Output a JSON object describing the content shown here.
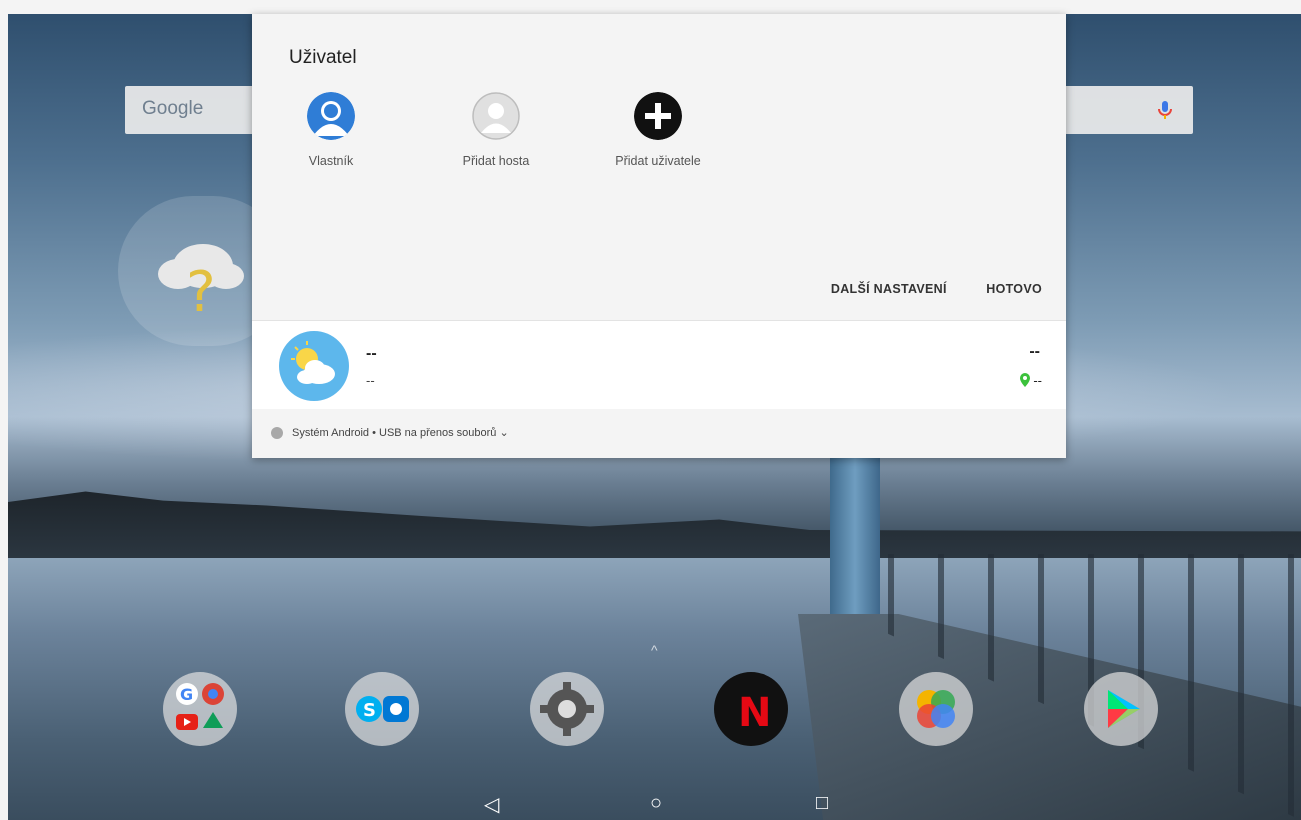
{
  "panel": {
    "title": "Uživatel",
    "users": [
      {
        "label": "Vlastník",
        "icon": "user-avatar-icon"
      },
      {
        "label": "Přidat hosta",
        "icon": "guest-avatar-icon"
      },
      {
        "label": "Přidat uživatele",
        "icon": "add-user-icon"
      }
    ],
    "more_settings": "DALŠÍ NASTAVENÍ",
    "done": "HOTOVO"
  },
  "weather_card": {
    "line1": "--",
    "line2": "--",
    "right1": "--",
    "right2": "--",
    "icon": "partly-cloudy-icon"
  },
  "notification": {
    "text": "Systém Android • USB na přenos souborů ⌄"
  },
  "search_bar": {
    "logo": "Google"
  },
  "nav": {
    "back": "◁",
    "home": "○",
    "recents": "□"
  },
  "colors": {
    "accent": "#2f7dd6",
    "weather_bg": "#5db7ec",
    "location": "#3cc23c"
  }
}
